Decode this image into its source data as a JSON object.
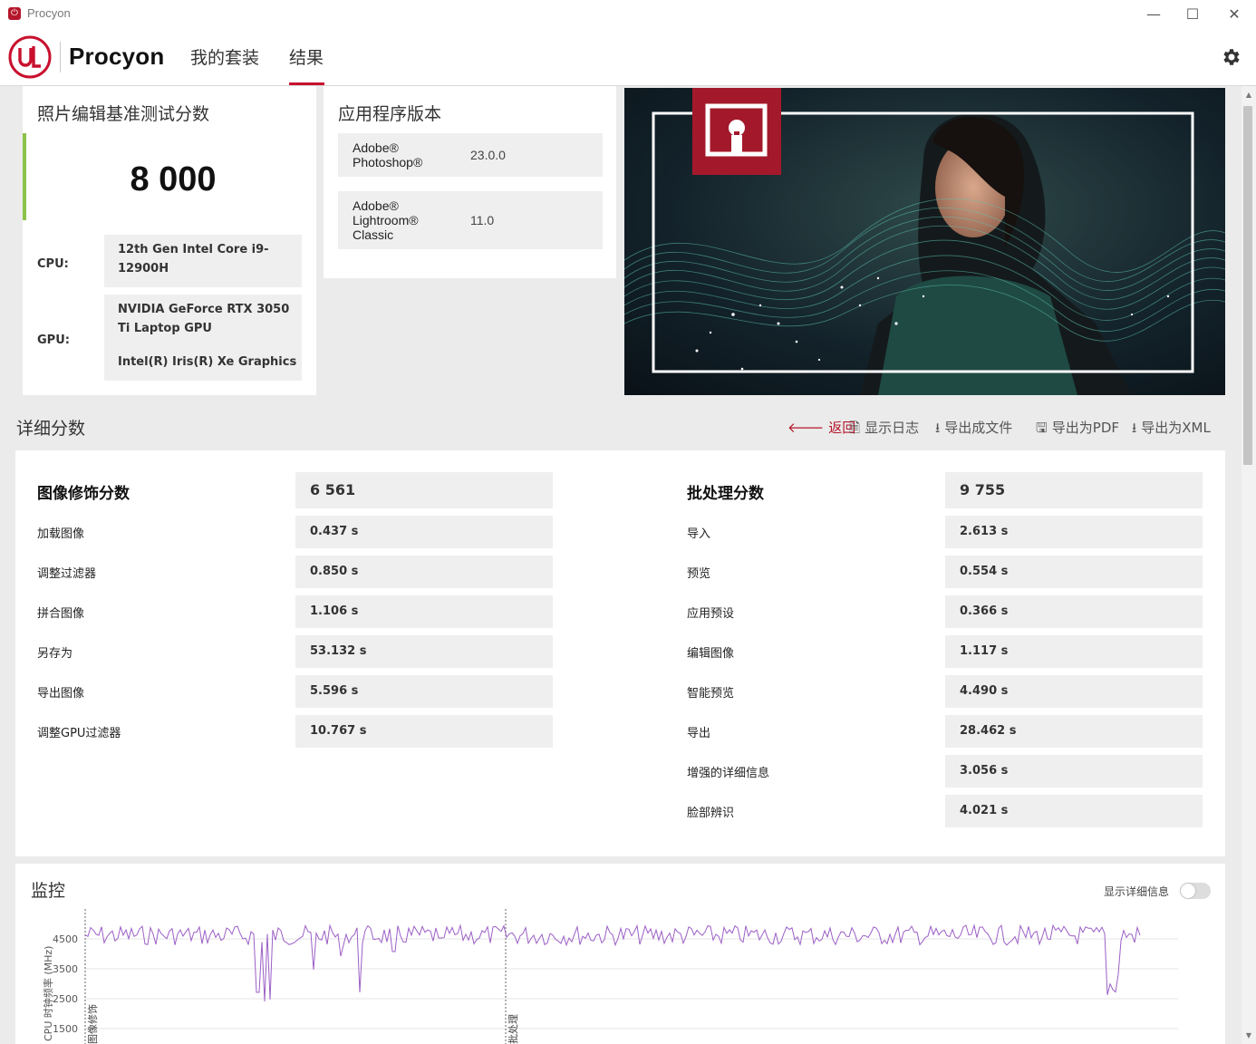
{
  "window": {
    "title": "Procyon"
  },
  "header": {
    "brand": "Procyon",
    "nav": [
      {
        "label": "我的套装",
        "active": false
      },
      {
        "label": "结果",
        "active": true
      }
    ],
    "logo_text": "UL"
  },
  "score_card": {
    "title": "照片编辑基准测试分数",
    "score": "8 000",
    "cpu_label": "CPU:",
    "cpu_value": "12th Gen Intel Core i9-12900H",
    "gpu_label": "GPU:",
    "gpu_value_1": "NVIDIA GeForce RTX 3050 Ti Laptop GPU",
    "gpu_value_2": "Intel(R) Iris(R) Xe Graphics"
  },
  "app_card": {
    "title": "应用程序版本",
    "apps": [
      {
        "name_1": "Adobe®",
        "name_2": "Photoshop®",
        "name_3": "",
        "version": "23.0.0"
      },
      {
        "name_1": "Adobe®",
        "name_2": "Lightroom®",
        "name_3": "Classic",
        "version": "11.0"
      }
    ]
  },
  "details": {
    "title": "详细分数",
    "actions": [
      {
        "label": "返回",
        "icon": "arrow-left-icon",
        "color": "#b5162b"
      },
      {
        "label": "显示日志",
        "icon": "document-icon"
      },
      {
        "label": "导出成文件",
        "icon": "download-icon"
      },
      {
        "label": "导出为PDF",
        "icon": "save-icon"
      },
      {
        "label": "导出为XML",
        "icon": "download-icon"
      }
    ],
    "left": {
      "head_label": "图像修饰分数",
      "head_value": "6 561",
      "rows": [
        {
          "label": "加载图像",
          "value": "0.437 s"
        },
        {
          "label": "调整过滤器",
          "value": "0.850 s"
        },
        {
          "label": "拼合图像",
          "value": "1.106 s"
        },
        {
          "label": "另存为",
          "value": "53.132 s"
        },
        {
          "label": "导出图像",
          "value": "5.596 s"
        },
        {
          "label": "调整GPU过滤器",
          "value": "10.767 s"
        }
      ]
    },
    "right": {
      "head_label": "批处理分数",
      "head_value": "9 755",
      "rows": [
        {
          "label": "导入",
          "value": "2.613 s"
        },
        {
          "label": "预览",
          "value": "0.554 s"
        },
        {
          "label": "应用预设",
          "value": "0.366 s"
        },
        {
          "label": "编辑图像",
          "value": "1.117 s"
        },
        {
          "label": "智能预览",
          "value": "4.490 s"
        },
        {
          "label": "导出",
          "value": "28.462 s"
        },
        {
          "label": "增强的详细信息",
          "value": "3.056 s"
        },
        {
          "label": "脸部辨识",
          "value": "4.021 s"
        }
      ]
    }
  },
  "monitor": {
    "title": "监控",
    "toggle_label": "显示详细信息",
    "toggle_on": false,
    "ylabel": "CPU 时钟频率 (MHz)",
    "y_ticks": [
      "4500",
      "3500",
      "2500",
      "1500"
    ],
    "marker_1": "图像修饰",
    "marker_2": "批处理",
    "line_color": "#9c5fc6"
  }
}
